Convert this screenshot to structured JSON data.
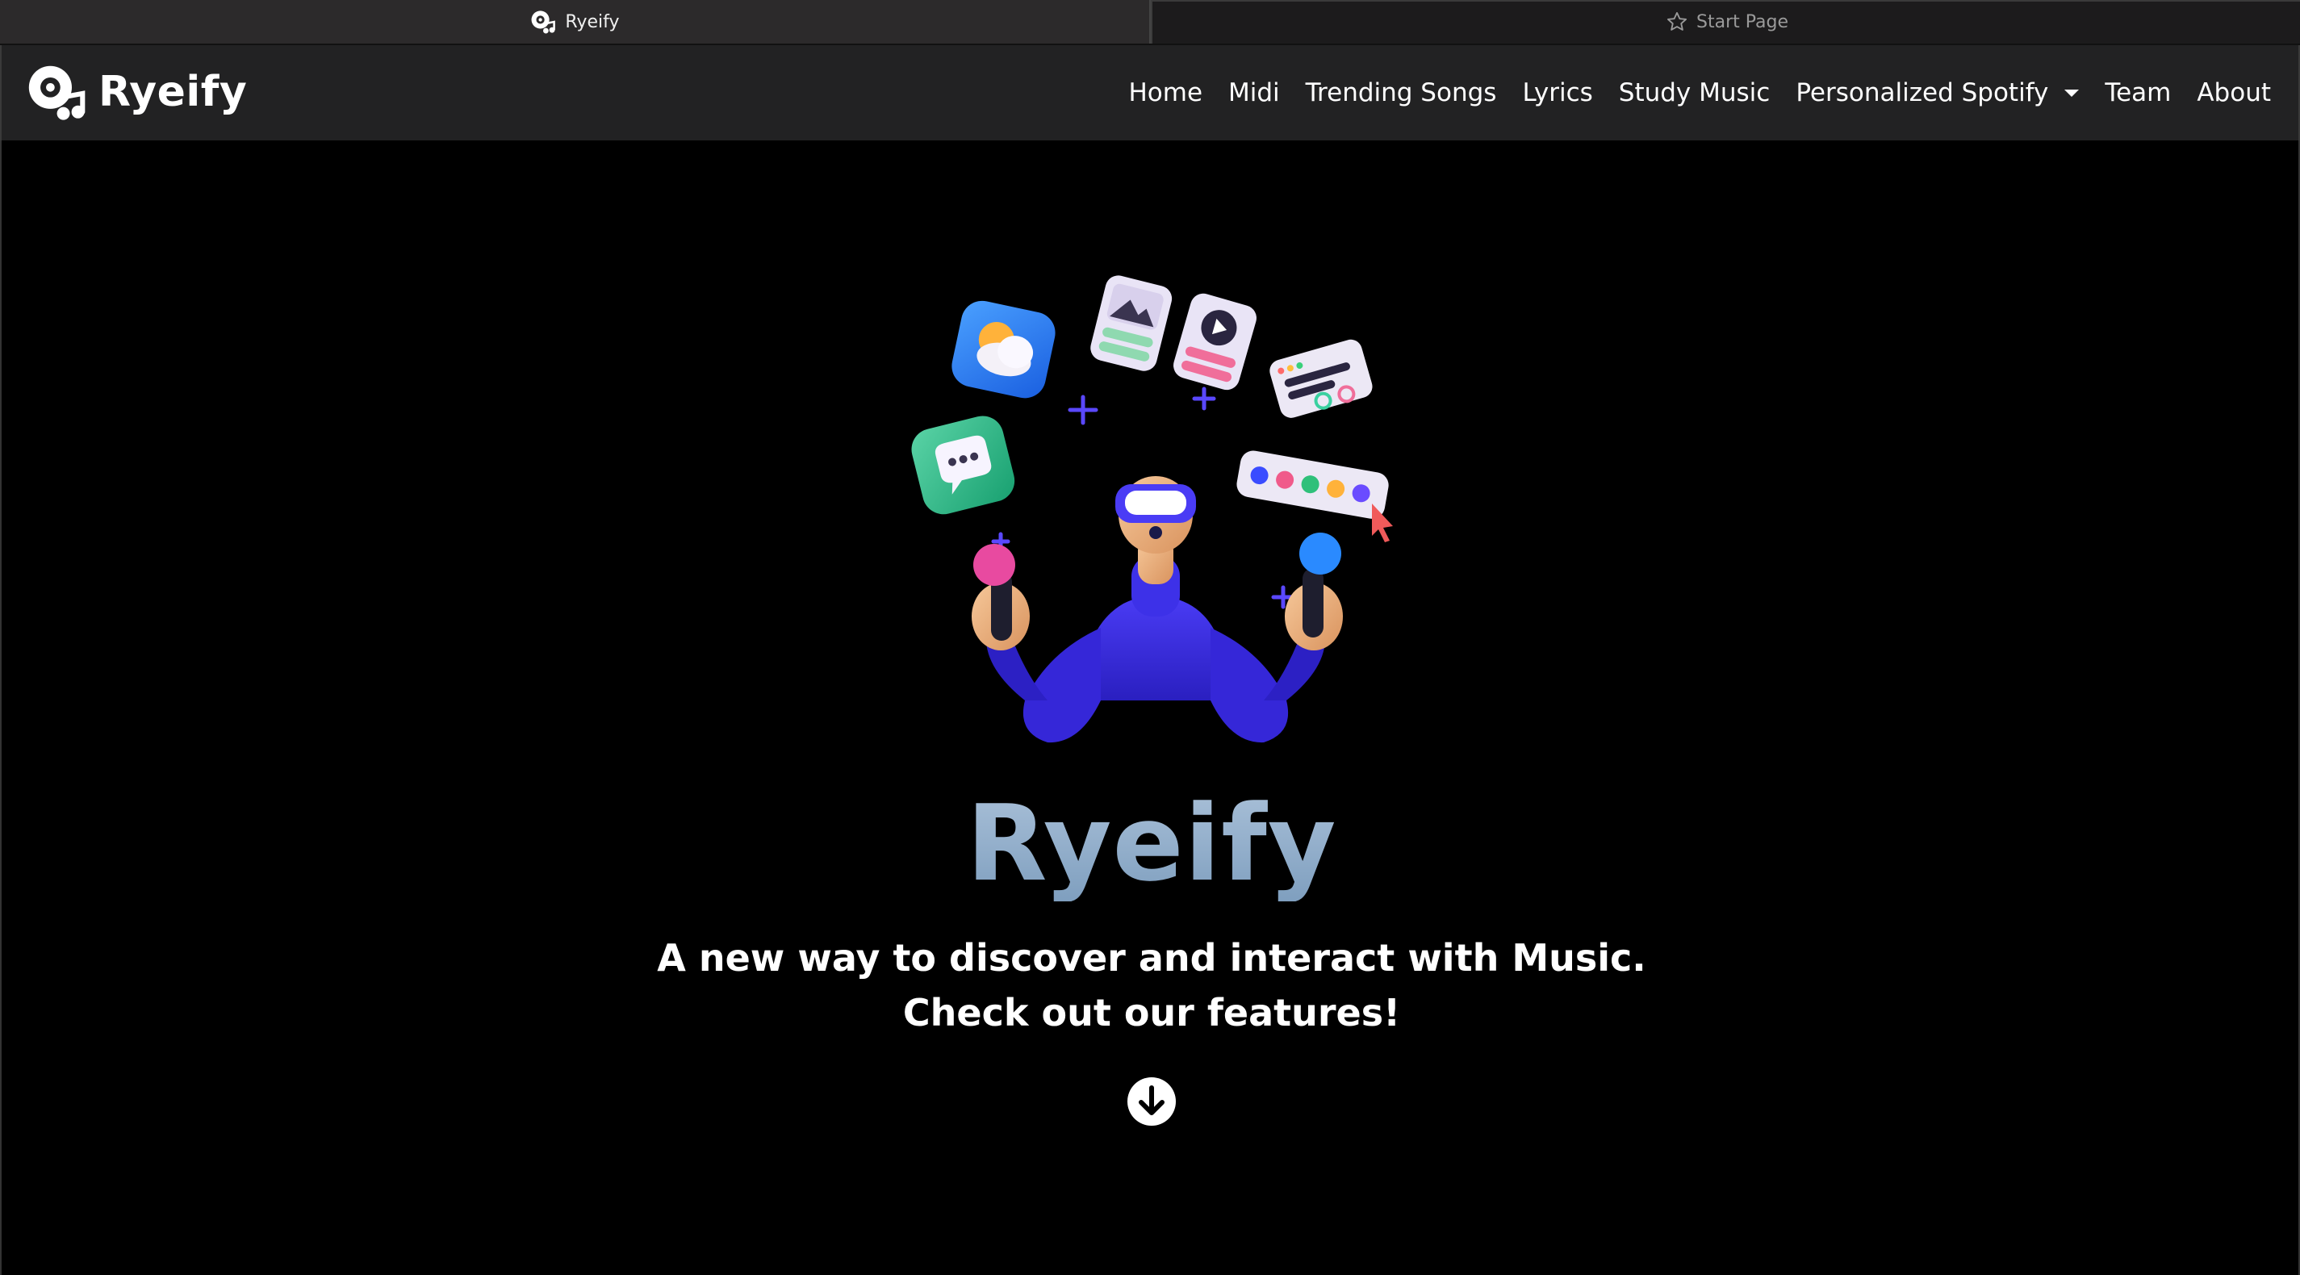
{
  "browser": {
    "tabs": [
      {
        "label": "Ryeify",
        "icon": "ryeify-logo-icon",
        "active": true
      },
      {
        "label": "Start Page",
        "icon": "star-icon",
        "active": false
      }
    ]
  },
  "navbar": {
    "brand": "Ryeify",
    "items": [
      {
        "label": "Home"
      },
      {
        "label": "Midi"
      },
      {
        "label": "Trending Songs"
      },
      {
        "label": "Lyrics"
      },
      {
        "label": "Study Music"
      },
      {
        "label": "Personalized Spotify",
        "dropdown": true
      },
      {
        "label": "Team"
      },
      {
        "label": "About"
      }
    ]
  },
  "hero": {
    "title": "Ryeify",
    "subtitle_line1": "A new way to discover and interact with Music.",
    "subtitle_line2": "Check out our features!",
    "scroll_icon": "arrow-down-circle-icon"
  },
  "colors": {
    "background": "#000000",
    "navbar": "#222223",
    "title_gradient_start": "#a9c0d8",
    "title_gradient_end": "#7f9fbf",
    "figure_blue": "#3d2fe0"
  }
}
